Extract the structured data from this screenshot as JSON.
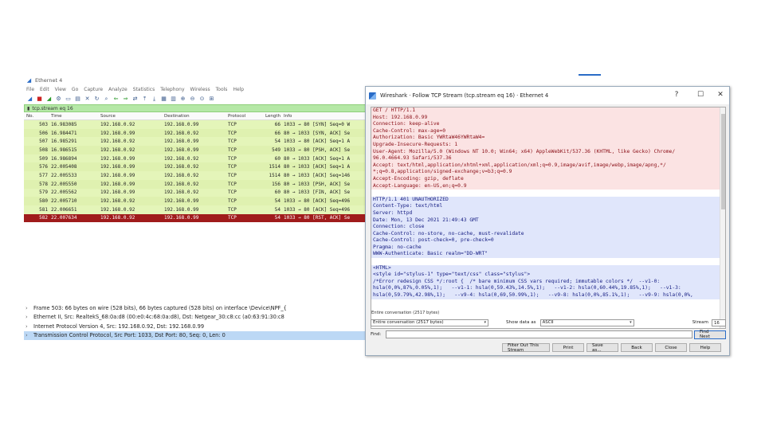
{
  "wireshark": {
    "title": "Ethernet 4",
    "menu": [
      "File",
      "Edit",
      "View",
      "Go",
      "Capture",
      "Analyze",
      "Statistics",
      "Telephony",
      "Wireless",
      "Tools",
      "Help"
    ],
    "filter": "tcp.stream eq 16",
    "columns": {
      "no": "No.",
      "time": "Time",
      "source": "Source",
      "destination": "Destination",
      "protocol": "Protocol",
      "length": "Length",
      "info": "Info"
    },
    "packets": [
      {
        "no": "503",
        "time": "16.983085",
        "src": "192.168.0.92",
        "dst": "192.168.0.99",
        "proto": "TCP",
        "len": "66",
        "info": "1033 → 80 [SYN] Seq=0 W"
      },
      {
        "no": "506",
        "time": "16.984471",
        "src": "192.168.0.99",
        "dst": "192.168.0.92",
        "proto": "TCP",
        "len": "66",
        "info": "80 → 1033 [SYN, ACK] Se"
      },
      {
        "no": "507",
        "time": "16.985291",
        "src": "192.168.0.92",
        "dst": "192.168.0.99",
        "proto": "TCP",
        "len": "54",
        "info": "1033 → 80 [ACK] Seq=1 A"
      },
      {
        "no": "508",
        "time": "16.986515",
        "src": "192.168.0.92",
        "dst": "192.168.0.99",
        "proto": "TCP",
        "len": "549",
        "info": "1033 → 80 [PSH, ACK] Se"
      },
      {
        "no": "509",
        "time": "16.986894",
        "src": "192.168.0.99",
        "dst": "192.168.0.92",
        "proto": "TCP",
        "len": "60",
        "info": "80 → 1033 [ACK] Seq=1 A"
      },
      {
        "no": "576",
        "time": "22.005408",
        "src": "192.168.0.99",
        "dst": "192.168.0.92",
        "proto": "TCP",
        "len": "1514",
        "info": "80 → 1033 [ACK] Seq=1 A"
      },
      {
        "no": "577",
        "time": "22.005533",
        "src": "192.168.0.99",
        "dst": "192.168.0.92",
        "proto": "TCP",
        "len": "1514",
        "info": "80 → 1033 [ACK] Seq=146"
      },
      {
        "no": "578",
        "time": "22.005550",
        "src": "192.168.0.99",
        "dst": "192.168.0.92",
        "proto": "TCP",
        "len": "156",
        "info": "80 → 1033 [PSH, ACK] Se"
      },
      {
        "no": "579",
        "time": "22.005562",
        "src": "192.168.0.99",
        "dst": "192.168.0.92",
        "proto": "TCP",
        "len": "60",
        "info": "80 → 1033 [FIN, ACK] Se"
      },
      {
        "no": "580",
        "time": "22.005710",
        "src": "192.168.0.92",
        "dst": "192.168.0.99",
        "proto": "TCP",
        "len": "54",
        "info": "1033 → 80 [ACK] Seq=496"
      },
      {
        "no": "581",
        "time": "22.006651",
        "src": "192.168.0.92",
        "dst": "192.168.0.99",
        "proto": "TCP",
        "len": "54",
        "info": "1033 → 80 [ACK] Seq=496"
      },
      {
        "no": "582",
        "time": "22.007634",
        "src": "192.168.0.92",
        "dst": "192.168.0.99",
        "proto": "TCP",
        "len": "54",
        "info": "1033 → 80 [RST, ACK] Se"
      }
    ],
    "details": [
      "Frame 503: 66 bytes on wire (528 bits), 66 bytes captured (528 bits) on interface \\Device\\NPF_{",
      "Ethernet II, Src: RealtekS_68:0a:d8 (00:e0:4c:68:0a:d8), Dst: Netgear_30:c8:cc (a0:63:91:30:c8",
      "Internet Protocol Version 4, Src: 192.168.0.92, Dst: 192.168.0.99",
      "Transmission Control Protocol, Src Port: 1033, Dst Port: 80, Seq: 0, Len: 0"
    ]
  },
  "dialog": {
    "title": "Wireshark · Follow TCP Stream (tcp.stream eq 16) · Ethernet 4",
    "stream_lines": [
      {
        "t": "cli",
        "s": "GET / HTTP/1.1"
      },
      {
        "t": "cli",
        "s": "Host: 192.168.0.99"
      },
      {
        "t": "cli",
        "s": "Connection: keep-alive"
      },
      {
        "t": "cli",
        "s": "Cache-Control: max-age=0"
      },
      {
        "t": "cli",
        "s": "Authorization: Basic YWRtaW46YWRtaW4="
      },
      {
        "t": "cli",
        "s": "Upgrade-Insecure-Requests: 1"
      },
      {
        "t": "cli",
        "s": "User-Agent: Mozilla/5.0 (Windows NT 10.0; Win64; x64) AppleWebKit/537.36 (KHTML, like Gecko) Chrome/"
      },
      {
        "t": "cli",
        "s": "96.0.4664.93 Safari/537.36"
      },
      {
        "t": "cli",
        "s": "Accept: text/html,application/xhtml+xml,application/xml;q=0.9,image/avif,image/webp,image/apng,*/"
      },
      {
        "t": "cli",
        "s": "*;q=0.8,application/signed-exchange;v=b3;q=0.9"
      },
      {
        "t": "cli",
        "s": "Accept-Encoding: gzip, deflate"
      },
      {
        "t": "cli",
        "s": "Accept-Language: en-US,en;q=0.9"
      },
      {
        "t": "blank",
        "s": ""
      },
      {
        "t": "srv",
        "s": "HTTP/1.1 401 UNAUTHORIZED"
      },
      {
        "t": "srv",
        "s": "Content-Type: text/html"
      },
      {
        "t": "srv",
        "s": "Server: httpd"
      },
      {
        "t": "srv",
        "s": "Date: Mon, 13 Dec 2021 21:49:43 GMT"
      },
      {
        "t": "srv",
        "s": "Connection: close"
      },
      {
        "t": "srv",
        "s": "Cache-Control: no-store, no-cache, must-revalidate"
      },
      {
        "t": "srv",
        "s": "Cache-Control: post-check=0, pre-check=0"
      },
      {
        "t": "srv",
        "s": "Pragma: no-cache"
      },
      {
        "t": "srv",
        "s": "WWW-Authenticate: Basic realm=\"DD-WRT\""
      },
      {
        "t": "blank",
        "s": ""
      },
      {
        "t": "srv",
        "s": "<HTML>"
      },
      {
        "t": "srv",
        "s": "<style id=\"stylus-1\" type=\"text/css\" class=\"stylus\">"
      },
      {
        "t": "srv",
        "s": "/*Error redesign CSS */:root {  /* bare minimum CSS vars required; immutable colors */  --v1-0:"
      },
      {
        "t": "srv",
        "s": "hsla(0,0%,87%,0.05%,1);   --v1-1: hsla(0,59.43%,14.5%,1);   --v1-2: hsla(0,60.44%,19.85%,1);   --v1-3:"
      },
      {
        "t": "srv",
        "s": "hsla(0,59.79%,42.98%,1);   --v9-4: hsla(0,69,50.99%,1);   --v9-8: hsla(0,0%,85.1%,1);   --v9-9: hsla(0,0%,"
      }
    ],
    "summary": "Entire conversation (2517 bytes)",
    "conversation_value": "Entire conversation (2517 bytes)",
    "show_data_as_label": "Show data as",
    "show_data_as_value": "ASCII",
    "stream_label": "Stream",
    "stream_value": "16",
    "find_label": "Find:",
    "find_next": "Find Next",
    "buttons": {
      "filter_out": "Filter Out This Stream",
      "print": "Print",
      "save_as": "Save as...",
      "back": "Back",
      "close": "Close",
      "help": "Help"
    }
  },
  "colors": {
    "client_text": "#8a0e16",
    "client_bg": "#fbe3e3",
    "server_text": "#141c82",
    "server_bg": "#e0e6fb",
    "row_green": "#e4f5b9",
    "row_selected": "#a01c1c",
    "filter_bg": "#b5e8a6"
  }
}
